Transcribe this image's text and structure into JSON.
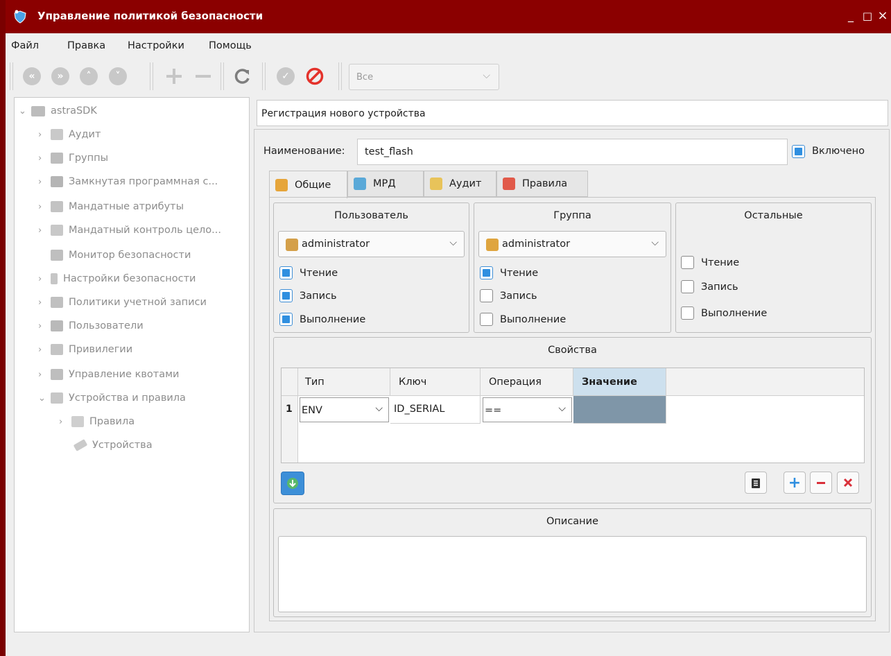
{
  "window": {
    "title": "Управление политикой безопасности",
    "minimize": "_",
    "maximize": "□",
    "close": "×"
  },
  "menu": [
    "Файл",
    "Правка",
    "Настройки",
    "Помощь"
  ],
  "toolbar": {
    "filter_value": "Все"
  },
  "tree": {
    "root": "astraSDK",
    "items": [
      "Аудит",
      "Группы",
      "Замкнутая программная с...",
      "Мандатные атрибуты",
      "Мандатный контроль цело...",
      "Монитор безопасности",
      "Настройки безопасности",
      "Политики учетной записи",
      "Пользователи",
      "Привилегии",
      "Управление квотами",
      "Устройства и правила",
      "Правила",
      "Устройства"
    ]
  },
  "panel": {
    "header": "Регистрация нового устройства",
    "name_label": "Наименование:",
    "name_value": "test_flash",
    "enabled_label": "Включено"
  },
  "tabs": [
    "Общие",
    "МРД",
    "Аудит",
    "Правила"
  ],
  "permissions": {
    "user": {
      "title": "Пользователь",
      "selected": "administrator",
      "read": "Чтение",
      "write": "Запись",
      "exec": "Выполнение"
    },
    "group": {
      "title": "Группа",
      "selected": "administrator",
      "read": "Чтение",
      "write": "Запись",
      "exec": "Выполнение"
    },
    "others": {
      "title": "Остальные",
      "read": "Чтение",
      "write": "Запись",
      "exec": "Выполнение"
    }
  },
  "properties": {
    "title": "Свойства",
    "columns": [
      "Тип",
      "Ключ",
      "Операция",
      "Значение"
    ],
    "row_index": "1",
    "row": {
      "type": "ENV",
      "key": "ID_SERIAL",
      "operation": "==",
      "value": ""
    }
  },
  "description": {
    "title": "Описание",
    "value": ""
  },
  "colors": {
    "titlebar": "#8b0000",
    "accent": "#2f8fe0",
    "selected_header": "#cde0ee",
    "value_cell": "#7f96a8"
  }
}
